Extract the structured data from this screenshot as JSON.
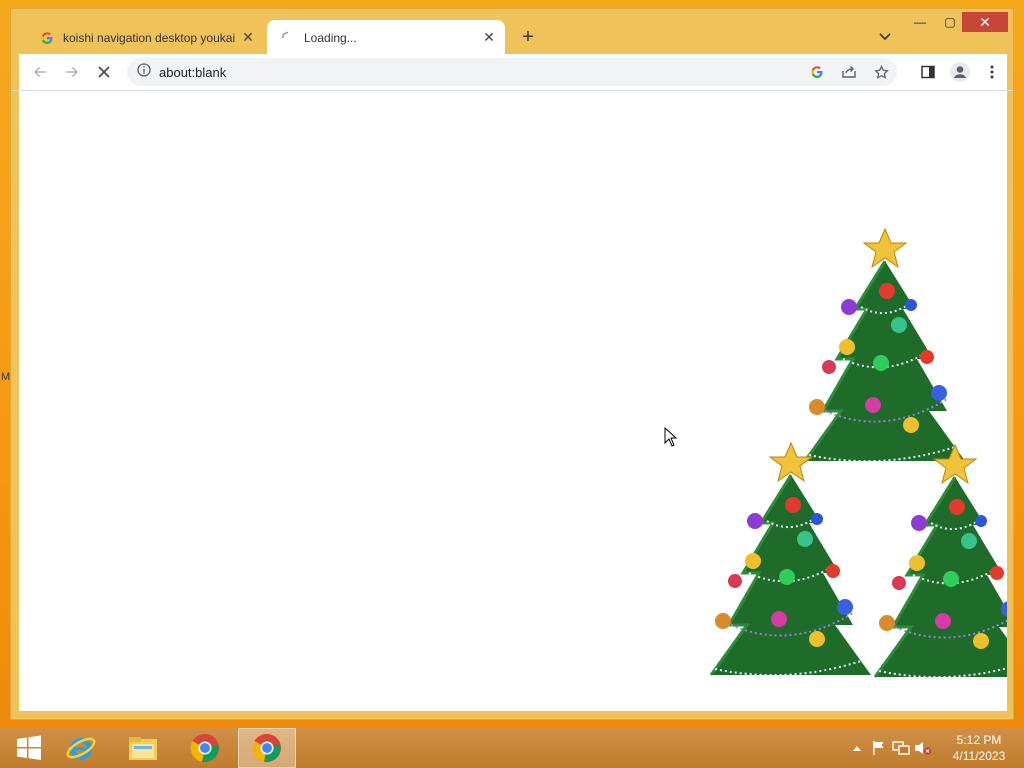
{
  "desktop": {
    "edge_label": "M"
  },
  "browser": {
    "tabs": [
      {
        "title": "koishi navigation desktop youkai",
        "icon": "google-g-icon",
        "state": "inactive"
      },
      {
        "title": "Loading...",
        "icon": "loading-spinner-icon",
        "state": "active"
      }
    ],
    "new_tab_label": "+",
    "window_controls": {
      "minimize": "—",
      "maximize": "▢",
      "close": "✕"
    },
    "address": {
      "url": "about:blank",
      "security_icon": "info-icon"
    },
    "toolbar_icons": [
      "back-arrow-icon",
      "forward-arrow-icon",
      "stop-loading-icon",
      "google-lens-icon",
      "share-icon",
      "bookmark-star-icon",
      "side-panel-icon",
      "profile-icon",
      "menu-kebab-icon"
    ]
  },
  "page": {
    "decorations": [
      "christmas-tree",
      "christmas-tree",
      "christmas-tree"
    ]
  },
  "taskbar": {
    "items": [
      "windows-start-icon",
      "internet-explorer-icon",
      "file-explorer-icon",
      "chrome-icon",
      "chrome-icon-active"
    ],
    "tray_icons": [
      "tray-expand-icon",
      "action-center-flag-icon",
      "network-icon",
      "volume-muted-icon"
    ],
    "clock": {
      "time": "5:12 PM",
      "date": "4/11/2023"
    }
  },
  "colors": {
    "accent": "#f6a21a",
    "tab_strip": "#f0c35a",
    "close_button": "#c7463a",
    "tree_green": "#1f6b2a"
  }
}
